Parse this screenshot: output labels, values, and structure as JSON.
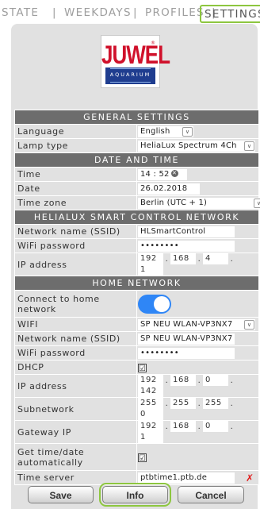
{
  "nav": {
    "tabs": [
      {
        "label": "STATE"
      },
      {
        "label": "WEEKDAYS"
      },
      {
        "label": "PROFILES"
      },
      {
        "label": "SETTINGS"
      }
    ],
    "separator": "|",
    "active_color": "#8dc63f"
  },
  "logo": {
    "brand": "JUWEL",
    "registered": "®",
    "sub": "AQUARIUM"
  },
  "sections": {
    "general": "GENERAL SETTINGS",
    "datetime": "DATE AND TIME",
    "network": "HELIALUX SMART CONTROL NETWORK",
    "home": "HOME NETWORK"
  },
  "general": {
    "language_label": "Language",
    "language_value": "English",
    "lamp_label": "Lamp type",
    "lamp_value": "HeliaLux Spectrum 4Ch"
  },
  "datetime": {
    "time_label": "Time",
    "time_value": "14 : 52",
    "date_label": "Date",
    "date_value": "26.02.2018",
    "tz_label": "Time zone",
    "tz_value": "Berlin (UTC + 1)"
  },
  "hlsc": {
    "ssid_label": "Network name (SSID)",
    "ssid_value": "HLSmartControl",
    "pw_label": "WiFi password",
    "pw_value": "••••••••",
    "ip_label": "IP address",
    "ip": [
      "192",
      "168",
      "4",
      "1"
    ]
  },
  "home": {
    "connect_label": "Connect to home network",
    "connect_on": true,
    "wifi_label": "WIFI",
    "wifi_value": "SP NEU WLAN-VP3NX7",
    "ssid_label": "Network name (SSID)",
    "ssid_value": "SP NEU WLAN-VP3NX7",
    "pw_label": "WiFi password",
    "pw_value": "••••••••",
    "dhcp_label": "DHCP",
    "dhcp_checked": true,
    "ip_label": "IP address",
    "ip": [
      "192",
      "168",
      "0",
      "142"
    ],
    "subnet_label": "Subnetwork",
    "subnet": [
      "255",
      "255",
      "255",
      "0"
    ],
    "gateway_label": "Gateway IP",
    "gateway": [
      "192",
      "168",
      "0",
      "1"
    ],
    "auto_label": "Get time/date automatically",
    "auto_checked": true,
    "server_label": "Time server",
    "server_value": "ptbtime1.ptb.de",
    "server_invalid": "✗"
  },
  "check_mark": "☑",
  "dropdown_icon": "chevron-down-icon",
  "buttons": {
    "save": "Save",
    "info": "Info",
    "cancel": "Cancel"
  }
}
